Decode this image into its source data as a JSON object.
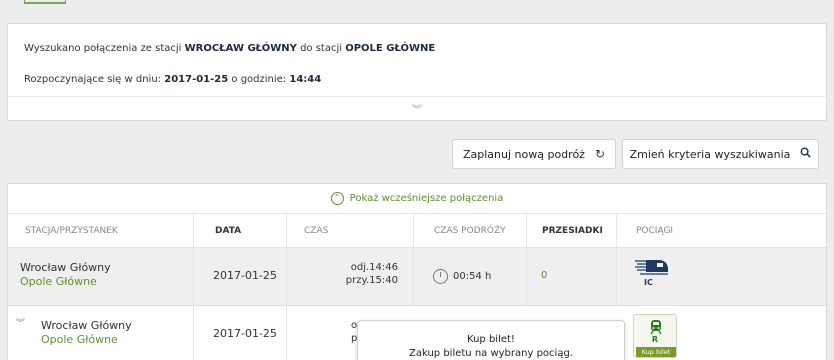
{
  "summary": {
    "line1_prefix": "Wyszukano połączenia ze stacji",
    "from_station": "WROCŁAW GŁÓWNY",
    "line1_middle": "do stacji",
    "to_station": "OPOLE GŁÓWNE",
    "line2_prefix": "Rozpoczynające się w dniu:",
    "date": "2017-01-25",
    "line2_middle": "o godzinie:",
    "time": "14:44",
    "expand_icon": "double-chevron-down"
  },
  "buttons": {
    "plan_label": "Zaplanuj nową podróż",
    "plan_icon": "refresh",
    "change_label": "Zmień kryteria wyszukiwania",
    "change_icon": "search"
  },
  "results": {
    "earlier_label": "Pokaż wcześniejsze połączenia",
    "columns": [
      "STACJA/PRZYSTANEK",
      "DATA",
      "CZAS",
      "CZAS PODRÓŻY",
      "PRZESIADKI",
      "POCIĄGI"
    ],
    "rows": [
      {
        "from": "Wrocław Główny",
        "to": "Opole Główne",
        "date": "2017-01-25",
        "departure": "odj.14:46",
        "arrival": "przy.15:40",
        "duration": "00:54 h",
        "transfers": "0",
        "train_label": "IC",
        "train_icon": "ic-train"
      },
      {
        "from": "Wrocław Główny",
        "to": "Opole Główne",
        "date": "2017-01-25",
        "departure": "o",
        "arrival": "p",
        "train_label": "R",
        "buy_label": "Kup bilet",
        "train_icon": "regional-train"
      }
    ]
  },
  "popup": {
    "title": "Kup bilet!",
    "text": "Zakup biletu na wybrany pociąg."
  },
  "colors": {
    "accent_green": "#5f8f2e",
    "navy": "#1d2b3a",
    "buy_badge": "#7a9a2a"
  }
}
